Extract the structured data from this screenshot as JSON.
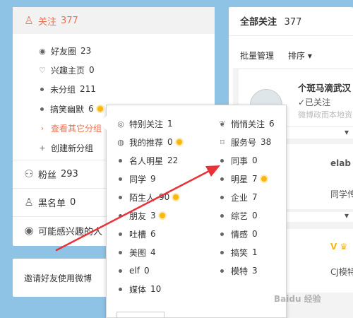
{
  "sidebar": {
    "follow": {
      "label": "关注",
      "count": "377"
    },
    "groups": [
      {
        "label": "好友圈",
        "count": "23",
        "icon": "circle-dot-icon"
      },
      {
        "label": "兴趣主页",
        "count": "0",
        "icon": "heart-icon"
      },
      {
        "label": "未分组",
        "count": "211",
        "icon": "dot-icon"
      },
      {
        "label": "搞笑幽默",
        "count": "6",
        "icon": "dot-icon"
      },
      {
        "label": "查看其它分组",
        "icon": "chevron-right-icon"
      },
      {
        "label": "创建新分组",
        "icon": "plus-icon"
      }
    ],
    "fans": {
      "label": "粉丝",
      "count": "293"
    },
    "blacklist": {
      "label": "黑名单",
      "count": "0"
    },
    "interested": {
      "label": "可能感兴趣的人"
    }
  },
  "invite": {
    "label": "邀请好友使用微博"
  },
  "main": {
    "title": "全部关注",
    "count": "377",
    "batch_label": "批量管理",
    "sort_label": "排序",
    "user_card": {
      "name": "个斑马滴武汉",
      "status": "已关注",
      "desc": "微博政而本地资",
      "partial_1": "elab",
      "partial_2": "同学传媒",
      "partial_3": "CJ模特"
    }
  },
  "popup": {
    "left_items": [
      {
        "label": "特别关注",
        "count": "1",
        "icon": "target-icon"
      },
      {
        "label": "我的推荐",
        "count": "0",
        "icon": "globe-icon",
        "vip": true
      },
      {
        "label": "名人明星",
        "count": "22"
      },
      {
        "label": "同学",
        "count": "9"
      },
      {
        "label": "陌生人",
        "count": "90",
        "vip": true
      },
      {
        "label": "朋友",
        "count": "3",
        "vip": true
      },
      {
        "label": "吐槽",
        "count": "6"
      },
      {
        "label": "美图",
        "count": "4"
      },
      {
        "label": "elf",
        "count": "0"
      },
      {
        "label": "媒体",
        "count": "10"
      }
    ],
    "right_items": [
      {
        "label": "悄悄关注",
        "count": "6",
        "icon": "leaf-icon"
      },
      {
        "label": "服务号",
        "count": "38",
        "icon": "bookmark-icon"
      },
      {
        "label": "同事",
        "count": "0"
      },
      {
        "label": "明星",
        "count": "7",
        "vip": true
      },
      {
        "label": "企业",
        "count": "7"
      },
      {
        "label": "综艺",
        "count": "0"
      },
      {
        "label": "情感",
        "count": "0"
      },
      {
        "label": "搞笑",
        "count": "1"
      },
      {
        "label": "模特",
        "count": "3"
      }
    ]
  },
  "annotation_color": "#e8323a",
  "accent_color": "#eb7350",
  "watermark": "Baidu 经验"
}
